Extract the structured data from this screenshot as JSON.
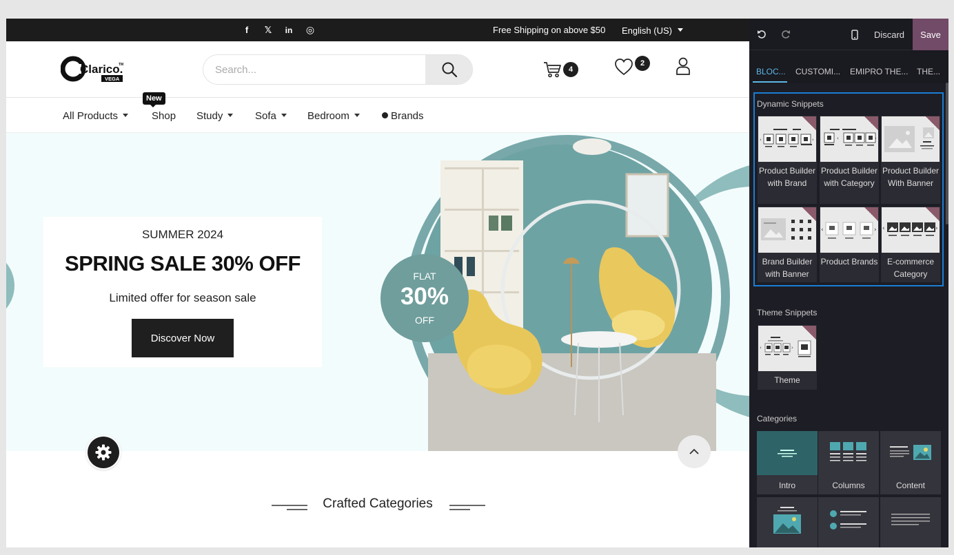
{
  "topbar": {
    "social": [
      "f",
      "𝕏",
      "in",
      "◎"
    ],
    "shipping": "Free Shipping on above $50",
    "language": "English (US)"
  },
  "header": {
    "search_placeholder": "Search...",
    "cart_count": "4",
    "wishlist_count": "2",
    "logo_text": "Clarico.",
    "logo_sub": "VEGA",
    "logo_tm": "TM"
  },
  "nav": {
    "items": [
      "All Products",
      "Shop",
      "Study",
      "Sofa",
      "Bedroom",
      "Brands"
    ],
    "new_tag": "New"
  },
  "hero": {
    "season": "SUMMER 2024",
    "headline": "SPRING SALE 30% OFF",
    "subline": "Limited offer for season sale",
    "cta": "Discover Now",
    "flat_top": "FLAT",
    "flat_value": "30%",
    "flat_bottom": "OFF"
  },
  "section": {
    "title": "Crafted Categories"
  },
  "panel": {
    "discard": "Discard",
    "save": "Save",
    "tabs": [
      "BLOC...",
      "CUSTOMI...",
      "EMIPRO THE...",
      "THE..."
    ],
    "dynamic_title": "Dynamic Snippets",
    "dynamic_snippets": [
      "Product Builder with Brand",
      "Product Builder with Category",
      "Product Builder With Banner",
      "Brand Builder with Banner",
      "Product Brands",
      "E-commerce Category"
    ],
    "theme_title": "Theme Snippets",
    "theme_snippets": [
      "Theme"
    ],
    "categories_title": "Categories",
    "categories": [
      "Intro",
      "Columns",
      "Content"
    ]
  },
  "colors": {
    "panel_bg": "#1d1d25",
    "save_bg": "#714b67",
    "active_tab": "#5cb8e6",
    "highlight_border": "#1b7ed6",
    "flat_badge": "#6f9e9c"
  }
}
